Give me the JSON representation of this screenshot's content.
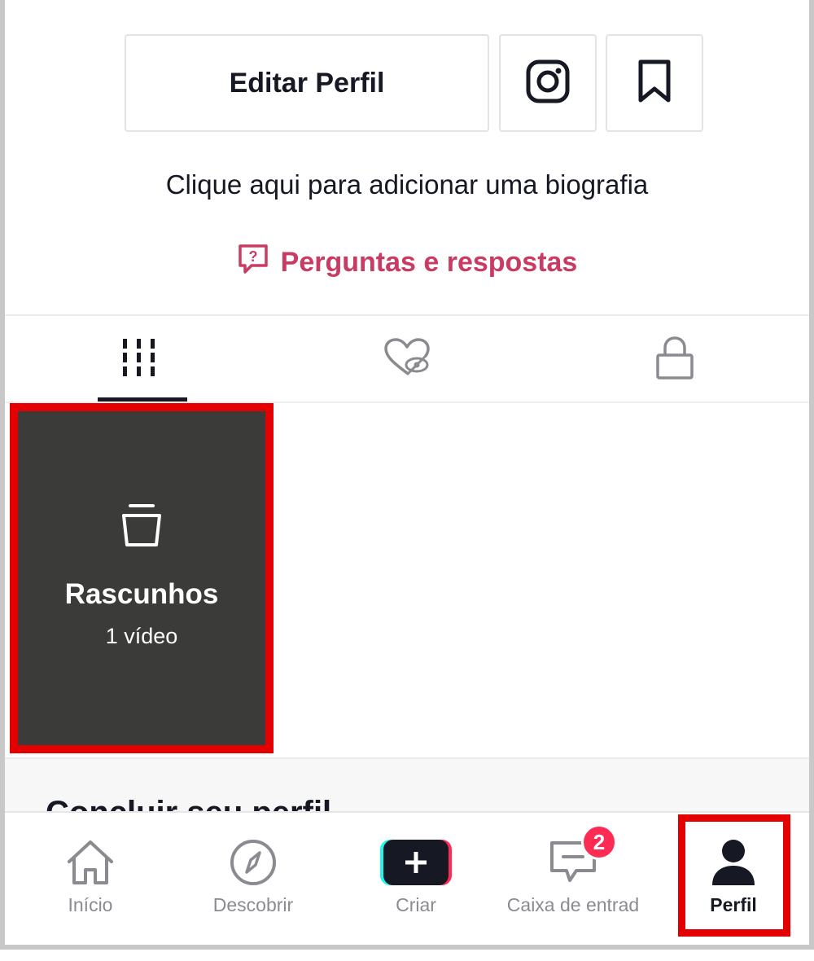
{
  "profile_actions": {
    "edit_label": "Editar Perfil",
    "instagram_icon": "instagram-icon",
    "bookmark_icon": "bookmark-icon"
  },
  "bio_prompt": "Clique aqui para adicionar uma biografia",
  "qa_link": {
    "label": "Perguntas e respostas",
    "icon": "question-bubble-icon",
    "color": "#c93b63"
  },
  "tabs": [
    {
      "icon": "grid-icon",
      "active": true
    },
    {
      "icon": "liked-hidden-icon",
      "active": false
    },
    {
      "icon": "lock-icon",
      "active": false
    }
  ],
  "drafts": {
    "title": "Rascunhos",
    "count": "1 vídeo",
    "icon": "drafts-box-icon"
  },
  "complete_profile_title": "Concluir seu perfil",
  "bottom_nav": {
    "home": "Início",
    "discover": "Descobrir",
    "create": "Criar",
    "inbox": "Caixa de entrad",
    "inbox_badge": "2",
    "profile": "Perfil"
  },
  "colors": {
    "highlight": "#e40000",
    "accent_pink": "#fe2c55",
    "accent_cyan": "#25f4ee",
    "text_dark": "#161823"
  }
}
